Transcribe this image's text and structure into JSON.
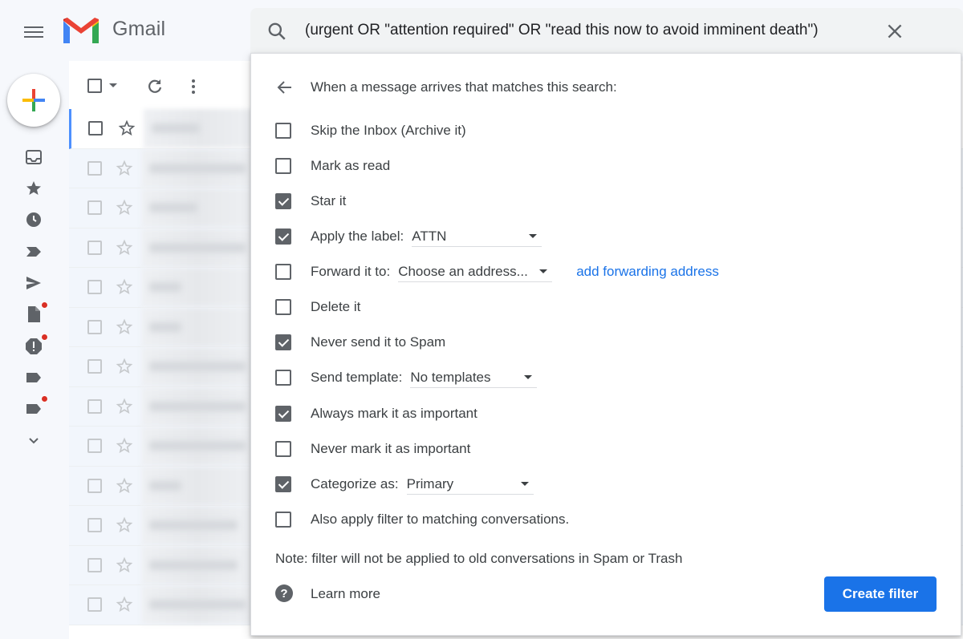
{
  "app": {
    "name": "Gmail",
    "colors": {
      "brand_red": "#ea4335",
      "accent_blue": "#1a73e8",
      "icon_gray": "#5f6368"
    }
  },
  "search": {
    "query": "(urgent OR \"attention required\" OR \"read this now to avoid imminent death\")"
  },
  "nav": {
    "icons": [
      "inbox-icon",
      "star-icon",
      "clock-icon",
      "important-icon",
      "send-icon",
      "draft-icon",
      "spam-icon",
      "label-icon",
      "label-icon",
      "chevron-down-icon"
    ]
  },
  "filter": {
    "title": "When a message arrives that matches this search:",
    "options": {
      "skip_inbox": {
        "label": "Skip the Inbox (Archive it)",
        "checked": false
      },
      "mark_read": {
        "label": "Mark as read",
        "checked": false
      },
      "star_it": {
        "label": "Star it",
        "checked": true
      },
      "apply_label": {
        "label": "Apply the label:",
        "checked": true,
        "value": "ATTN"
      },
      "forward": {
        "label": "Forward it to:",
        "checked": false,
        "value": "Choose an address...",
        "link": "add forwarding address"
      },
      "delete": {
        "label": "Delete it",
        "checked": false
      },
      "never_spam": {
        "label": "Never send it to Spam",
        "checked": true
      },
      "send_template": {
        "label": "Send template:",
        "checked": false,
        "value": "No templates"
      },
      "always_important": {
        "label": "Always mark it as important",
        "checked": true
      },
      "never_important": {
        "label": "Never mark it as important",
        "checked": false
      },
      "categorize": {
        "label": "Categorize as:",
        "checked": true,
        "value": "Primary"
      },
      "also_apply": {
        "label": "Also apply filter to matching conversations.",
        "checked": false
      }
    },
    "note": "Note: filter will not be applied to old conversations in Spam or Trash",
    "learn_more": "Learn more",
    "create_button": "Create filter",
    "help_glyph": "?"
  }
}
